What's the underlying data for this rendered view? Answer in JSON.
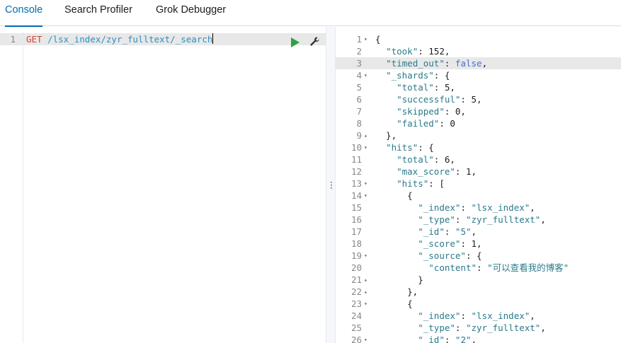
{
  "tabs": [
    {
      "label": "Console",
      "active": true
    },
    {
      "label": "Search Profiler",
      "active": false
    },
    {
      "label": "Grok Debugger",
      "active": false
    }
  ],
  "request": {
    "line_number": "1",
    "method": "GET",
    "url": "/lsx_index/zyr_fulltext/_search"
  },
  "response": {
    "lines": [
      {
        "n": "1",
        "fold": "▾",
        "text": "{"
      },
      {
        "n": "2",
        "fold": "",
        "text": "  \"took\": 152,"
      },
      {
        "n": "3",
        "fold": "",
        "text": "  \"timed_out\": false,"
      },
      {
        "n": "4",
        "fold": "▾",
        "text": "  \"_shards\": {"
      },
      {
        "n": "5",
        "fold": "",
        "text": "    \"total\": 5,"
      },
      {
        "n": "6",
        "fold": "",
        "text": "    \"successful\": 5,"
      },
      {
        "n": "7",
        "fold": "",
        "text": "    \"skipped\": 0,"
      },
      {
        "n": "8",
        "fold": "",
        "text": "    \"failed\": 0"
      },
      {
        "n": "9",
        "fold": "▴",
        "text": "  },"
      },
      {
        "n": "10",
        "fold": "▾",
        "text": "  \"hits\": {"
      },
      {
        "n": "11",
        "fold": "",
        "text": "    \"total\": 6,"
      },
      {
        "n": "12",
        "fold": "",
        "text": "    \"max_score\": 1,"
      },
      {
        "n": "13",
        "fold": "▾",
        "text": "    \"hits\": ["
      },
      {
        "n": "14",
        "fold": "▾",
        "text": "      {"
      },
      {
        "n": "15",
        "fold": "",
        "text": "        \"_index\": \"lsx_index\","
      },
      {
        "n": "16",
        "fold": "",
        "text": "        \"_type\": \"zyr_fulltext\","
      },
      {
        "n": "17",
        "fold": "",
        "text": "        \"_id\": \"5\","
      },
      {
        "n": "18",
        "fold": "",
        "text": "        \"_score\": 1,"
      },
      {
        "n": "19",
        "fold": "▾",
        "text": "        \"_source\": {"
      },
      {
        "n": "20",
        "fold": "",
        "text": "          \"content\": \"可以查看我的博客\""
      },
      {
        "n": "21",
        "fold": "▴",
        "text": "        }"
      },
      {
        "n": "22",
        "fold": "▴",
        "text": "      },"
      },
      {
        "n": "23",
        "fold": "▾",
        "text": "      {"
      },
      {
        "n": "24",
        "fold": "",
        "text": "        \"_index\": \"lsx_index\","
      },
      {
        "n": "25",
        "fold": "",
        "text": "        \"_type\": \"zyr_fulltext\","
      },
      {
        "n": "26",
        "fold": "▾",
        "text": "        \"_id\": \"2\","
      }
    ],
    "highlighted_line": "3"
  },
  "colors": {
    "active_tab": "#006bb4",
    "method": "#d6432b",
    "url": "#2b8fc7",
    "key": "#2a7a8a",
    "boolean": "#4a6fd1",
    "run": "#2ea043"
  },
  "icons": {
    "run": "play-icon",
    "settings": "wrench-icon",
    "resize": "vertical-dots-icon"
  }
}
